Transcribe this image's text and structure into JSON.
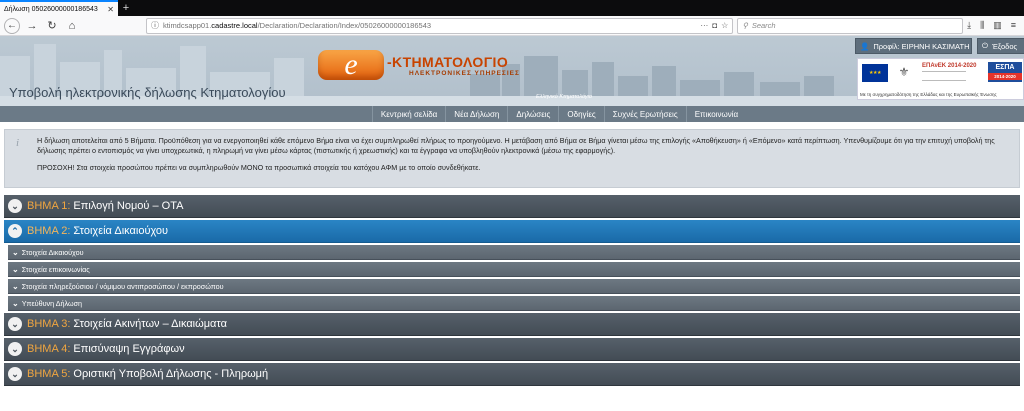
{
  "browser": {
    "tab_title": "Δήλωση 05026000000186543",
    "url_host": "ktimdcsapp01.cadastre.local",
    "url_path": "/Declaration/Declaration/Index/05026000000186543",
    "url_prefix": "ktimdcsapp01.",
    "url_domain": "cadastre.local",
    "search_placeholder": "Search"
  },
  "header": {
    "site_title": "Υποβολή ηλεκτρονικής δήλωσης Κτηματολογίου",
    "logo_name": "-ΚΤΗΜΑΤΟΛΟΓΙΟ",
    "logo_e": "e",
    "logo_sub": "ΗΛΕΚΤΡΟΝΙΚΕΣ ΥΠΗΡΕΣΙΕΣ",
    "logo_tag": "Ελληνικό Κτηματολόγιο",
    "profile_label": "Προφίλ: ΕΙΡΗΝΗ ΚΑΣΙΜΑΤΗ",
    "logout_label": "Έξοδος",
    "eu_epa": "ΕΠΑνΕΚ 2014-2020",
    "eu_espa": "ΕΣΠΑ",
    "eu_espa_years": "2014-2020",
    "eu_caption": "Με τη συγχρηματοδότηση της Ελλάδας και της Ευρωπαϊκής Ένωσης"
  },
  "nav": [
    {
      "label": "Κεντρική σελίδα"
    },
    {
      "label": "Νέα Δήλωση"
    },
    {
      "label": "Δηλώσεις"
    },
    {
      "label": "Οδηγίες"
    },
    {
      "label": "Συχνές Ερωτήσεις"
    },
    {
      "label": "Επικοινωνία"
    }
  ],
  "info": {
    "text": "Η δήλωση αποτελείται από 5 Βήματα. Προϋπόθεση για να ενεργοποιηθεί κάθε επόμενο Βήμα είναι να έχει συμπληρωθεί πλήρως το προηγούμενο. Η μετάβαση από Βήμα σε Βήμα γίνεται μέσω της επιλογής «Αποθήκευση» ή «Επόμενο» κατά περίπτωση. Υπενθυμίζουμε ότι για την επιτυχή υποβολή της δήλωσης πρέπει ο εντοπισμός να γίνει υποχρεωτικά, η πληρωμή να γίνει μέσω κάρτας (πιστωτικής ή χρεωστικής) και τα έγγραφα να υποβληθούν ηλεκτρονικά (μέσω της εφαρμογής).",
    "warning": "ΠΡΟΣΟΧΗ! Στα στοιχεία προσώπου πρέπει να συμπληρωθούν ΜΟΝΟ τα προσωπικά στοιχεία του κατόχου ΑΦΜ με το οποίο συνδεθήκατε."
  },
  "steps": [
    {
      "num": "ΒΗΜΑ 1:",
      "label": "Επιλογή Νομού – ΟΤΑ"
    },
    {
      "num": "ΒΗΜΑ 2:",
      "label": "Στοιχεία Δικαιούχου"
    },
    {
      "num": "ΒΗΜΑ 3:",
      "label": "Στοιχεία Ακινήτων – Δικαιώματα"
    },
    {
      "num": "ΒΗΜΑ 4:",
      "label": "Επισύναψη Εγγράφων"
    },
    {
      "num": "ΒΗΜΑ 5:",
      "label": "Οριστική Υποβολή Δήλωσης - Πληρωμή"
    }
  ],
  "substeps": [
    {
      "label": "Στοιχεία Δικαιούχου"
    },
    {
      "label": "Στοιχεία επικοινωνίας"
    },
    {
      "label": "Στοιχεία πληρεξούσιου / νόμιμου αντιπροσώπου / εκπροσώπου"
    },
    {
      "label": "Υπεύθυνη Δήλωση"
    }
  ],
  "colors": {
    "active_step": "#1a6aa8",
    "step_number": "#f0a640",
    "logo_orange": "#e4600c"
  }
}
